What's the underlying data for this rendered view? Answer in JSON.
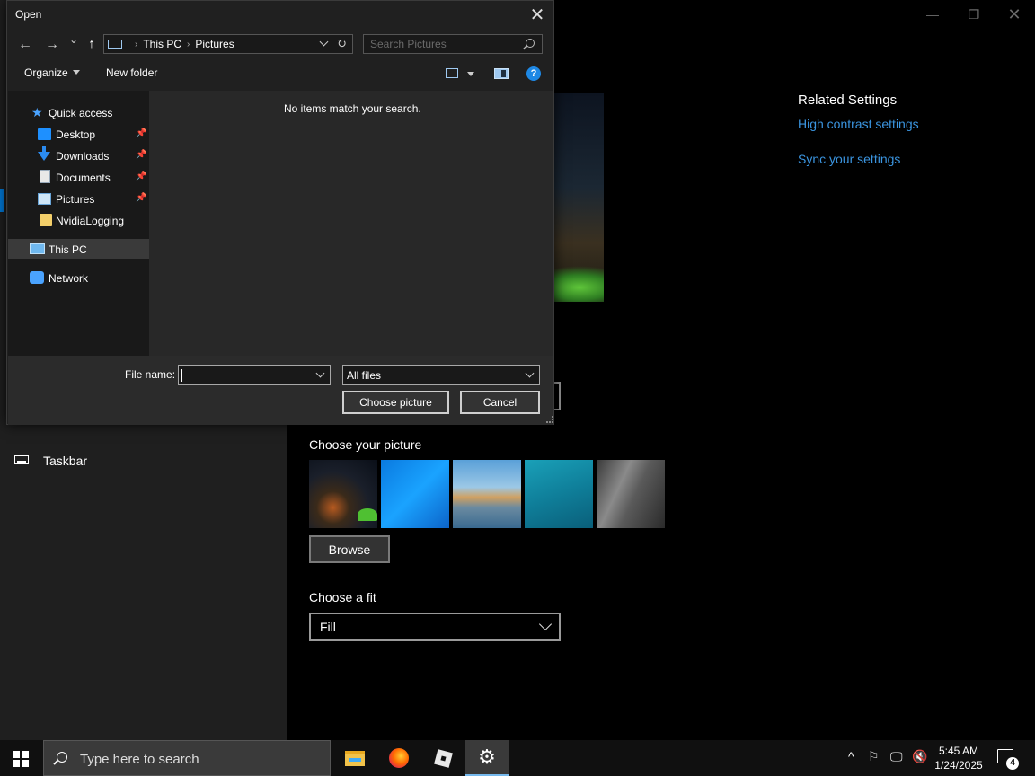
{
  "dialog": {
    "title": "Open",
    "close_glyph": "✕",
    "nav": {
      "back_glyph": "←",
      "forward_glyph": "→",
      "recent_glyph": "⌄",
      "up_glyph": "↑"
    },
    "address": {
      "segments": [
        "This PC",
        "Pictures"
      ],
      "separator": "›",
      "refresh_glyph": "↻"
    },
    "search_placeholder": "Search Pictures",
    "toolbar": {
      "organize": "Organize",
      "new_folder": "New folder",
      "help_glyph": "?"
    },
    "tree": [
      {
        "label": "Quick access",
        "icon": "star-icon"
      },
      {
        "label": "Desktop",
        "icon": "desktop-folder-icon",
        "pinned": true
      },
      {
        "label": "Downloads",
        "icon": "download-arrow-icon",
        "pinned": true
      },
      {
        "label": "Documents",
        "icon": "document-icon",
        "pinned": true
      },
      {
        "label": "Pictures",
        "icon": "pictures-folder-icon",
        "pinned": true
      },
      {
        "label": "NvidiaLogging",
        "icon": "folder-icon"
      },
      {
        "label": "This PC",
        "icon": "computer-icon",
        "selected": true
      },
      {
        "label": "Network",
        "icon": "network-icon"
      }
    ],
    "pin_glyph": "📌",
    "empty_message": "No items match your search.",
    "file_name_label": "File name:",
    "file_name_value": "",
    "file_type": "All files",
    "choose_button": "Choose picture",
    "cancel_button": "Cancel"
  },
  "settings": {
    "window_controls": {
      "minimize": "—",
      "maximize": "❐",
      "close": "✕"
    },
    "nav_item": "Taskbar",
    "choose_picture_title": "Choose your picture",
    "thumbnails": [
      "night-sky-tent",
      "windows-blue",
      "beach-rocks",
      "underwater-swimmer",
      "rock-cliff"
    ],
    "browse_button": "Browse",
    "choose_fit_title": "Choose a fit",
    "fit_value": "Fill",
    "related_settings_title": "Related Settings",
    "related_links": [
      "High contrast settings",
      "Sync your settings"
    ],
    "link_color": "#3b95e0"
  },
  "taskbar": {
    "search_placeholder": "Type here to search",
    "apps": [
      "file-explorer",
      "firefox",
      "roblox",
      "settings"
    ],
    "active_app": "settings",
    "tray": {
      "chevron_glyph": "^",
      "notification_count": "4"
    },
    "time": "5:45 AM",
    "date": "1/24/2025",
    "accent_color": "#76b9ed"
  }
}
